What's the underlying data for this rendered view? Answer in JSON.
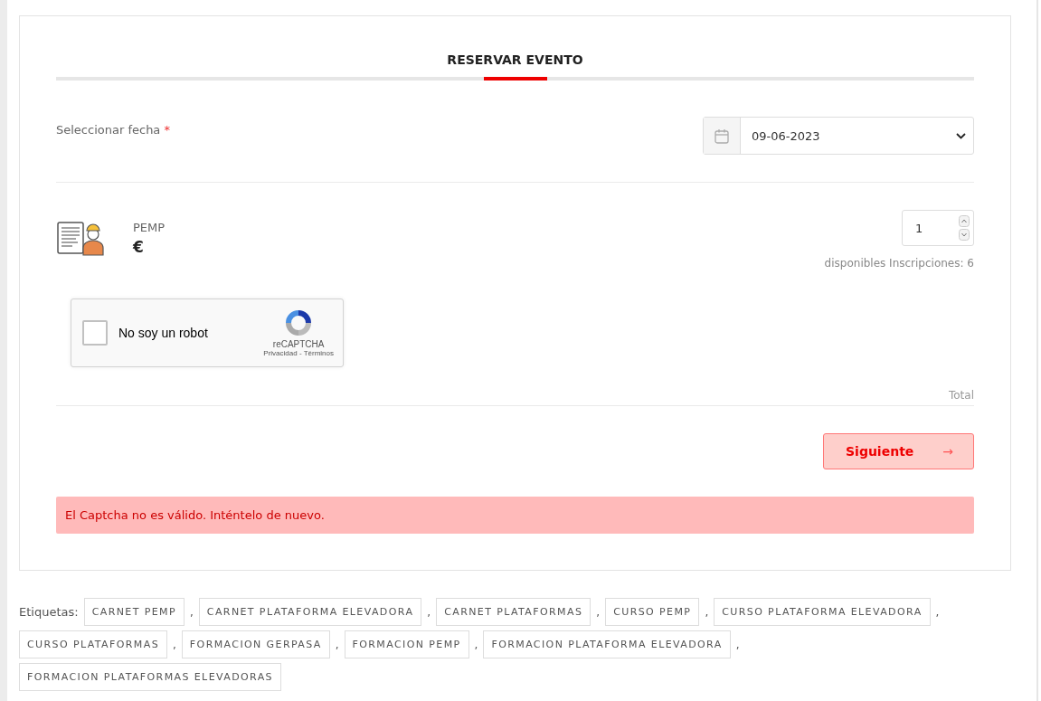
{
  "header": {
    "title": "RESERVAR EVENTO"
  },
  "date_field": {
    "label": "Seleccionar fecha",
    "required_mark": "*",
    "value": "09-06-2023"
  },
  "ticket": {
    "name": "PEMP",
    "price": "€",
    "quantity": "1",
    "availability": "disponibles Inscripciones: 6"
  },
  "captcha": {
    "checked": false,
    "label": "No soy un robot",
    "brand": "reCAPTCHA",
    "privacy": "Privacidad",
    "dash": "-",
    "terms": "Términos"
  },
  "total_label": "Total",
  "next_button": {
    "label": "Siguiente",
    "icon": "→"
  },
  "error_message": "El Captcha no es válido. Inténtelo de nuevo.",
  "tags": {
    "label": "Etiquetas:",
    "items": [
      {
        "label": "CARNET PEMP",
        "separator": ","
      },
      {
        "label": "CARNET PLATAFORMA ELEVADORA",
        "separator": ","
      },
      {
        "label": "CARNET PLATAFORMAS",
        "separator": ","
      },
      {
        "label": "CURSO PEMP",
        "separator": ","
      },
      {
        "label": "CURSO PLATAFORMA ELEVADORA",
        "separator": ","
      },
      {
        "label": "CURSO PLATAFORMAS",
        "separator": ","
      },
      {
        "label": "FORMACION GERPASA",
        "separator": ","
      },
      {
        "label": "FORMACION PEMP",
        "separator": ","
      },
      {
        "label": "FORMACION PLATAFORMA ELEVADORA",
        "separator": ","
      },
      {
        "label": "FORMACION PLATAFORMAS ELEVADORAS"
      }
    ]
  }
}
